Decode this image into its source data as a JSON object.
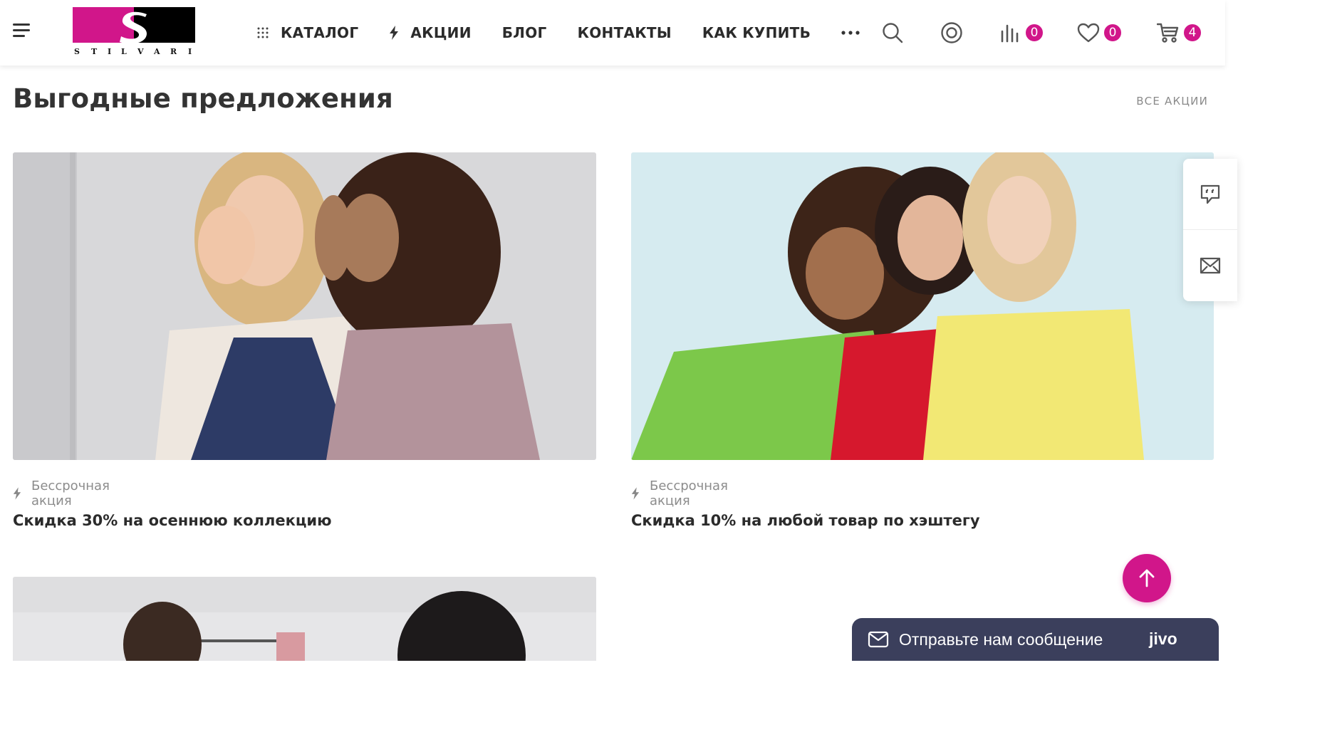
{
  "brand": {
    "logo_text": "STILVARI",
    "logo_letter": "S",
    "accent_color": "#d1168a"
  },
  "header": {
    "menu_icon": "hamburger-icon",
    "nav": [
      {
        "label": "КАТАЛОГ",
        "icon": "grid-dots-icon"
      },
      {
        "label": "АКЦИИ",
        "icon": "lightning-icon"
      },
      {
        "label": "БЛОГ",
        "icon": ""
      },
      {
        "label": "КОНТАКТЫ",
        "icon": ""
      },
      {
        "label": "КАК КУПИТЬ",
        "icon": ""
      }
    ],
    "more_icon": "more-dots-icon",
    "icons": {
      "search": "search-icon",
      "account": "user-circle-icon",
      "compare": {
        "icon": "compare-bars-icon",
        "count": "0"
      },
      "favorites": {
        "icon": "heart-icon",
        "count": "0"
      },
      "cart": {
        "icon": "cart-icon",
        "count": "4"
      }
    }
  },
  "section": {
    "title": "Выгодные предложения",
    "all_link": "ВСЕ АКЦИИ"
  },
  "promos": [
    {
      "meta": "Бессрочная акция",
      "title": "Скидка 30% на осеннюю коллекцию"
    },
    {
      "meta": "Бессрочная акция",
      "title": "Скидка 10% на любой товар по хэштегу"
    }
  ],
  "side_widget": {
    "chat_icon": "chat-bubble-icon",
    "mail_icon": "envelope-icon"
  },
  "scroll_top_icon": "arrow-up-icon",
  "jivo": {
    "message": "Отправьте нам сообщение",
    "brand": "jivo"
  }
}
